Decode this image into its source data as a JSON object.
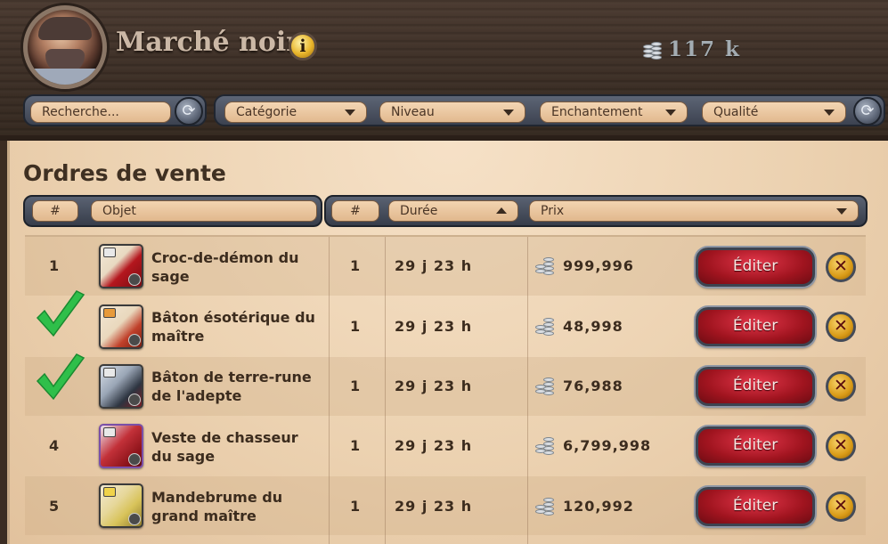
{
  "header": {
    "title": "Marché noir",
    "balance": "117 k"
  },
  "filters": {
    "search_placeholder": "Recherche...",
    "category": "Catégorie",
    "level": "Niveau",
    "enchantment": "Enchantement",
    "quality": "Qualité"
  },
  "section": {
    "title": "Ordres de vente"
  },
  "columns": {
    "num": "#",
    "item": "Objet",
    "qty": "#",
    "duration": "Durée",
    "price": "Prix"
  },
  "orders": [
    {
      "index": "1",
      "name_l1": "Croc-de-démon du",
      "name_l2": "sage",
      "qty": "1",
      "duration": "29 j 23 h",
      "price": "999,996",
      "checked": false,
      "icon_color": "#b4161e"
    },
    {
      "index": "",
      "name_l1": "Bâton ésotérique du",
      "name_l2": "maître",
      "qty": "1",
      "duration": "29 j 23 h",
      "price": "48,998",
      "checked": true,
      "icon_color": "#a0321a"
    },
    {
      "index": "",
      "name_l1": "Bâton de terre-rune",
      "name_l2": "de l'adepte",
      "qty": "1",
      "duration": "29 j 23 h",
      "price": "76,988",
      "checked": true,
      "icon_color": "#2d3440"
    },
    {
      "index": "4",
      "name_l1": "Veste de chasseur",
      "name_l2": "du sage",
      "qty": "1",
      "duration": "29 j 23 h",
      "price": "6,799,998",
      "checked": false,
      "icon_color": "#b01a22"
    },
    {
      "index": "5",
      "name_l1": "Mandebrume du",
      "name_l2": "grand maître",
      "qty": "1",
      "duration": "29 j 23 h",
      "price": "120,992",
      "checked": false,
      "icon_color": "#d8c35a"
    }
  ],
  "actions": {
    "edit_label": "Éditer",
    "cancel_symbol": "✕",
    "info_symbol": "i",
    "refresh_symbol": "⟳"
  }
}
